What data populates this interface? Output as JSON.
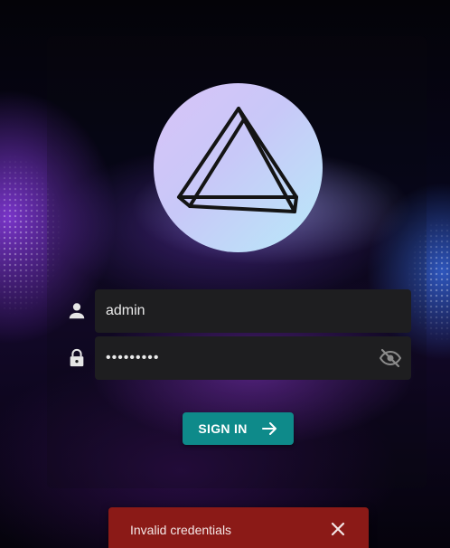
{
  "login": {
    "username": {
      "value": "admin",
      "icon": "person-icon"
    },
    "password": {
      "value": "•••••••••",
      "icon": "lock-icon",
      "toggle_icon": "eye-off-icon"
    },
    "submit": {
      "label": "SIGN IN",
      "icon": "arrow-right-icon",
      "color": "#0e8a8a"
    },
    "logo": "triangle-logo-icon"
  },
  "toast": {
    "message": "Invalid credentials",
    "close_icon": "close-icon",
    "color": "#8b1a17"
  }
}
